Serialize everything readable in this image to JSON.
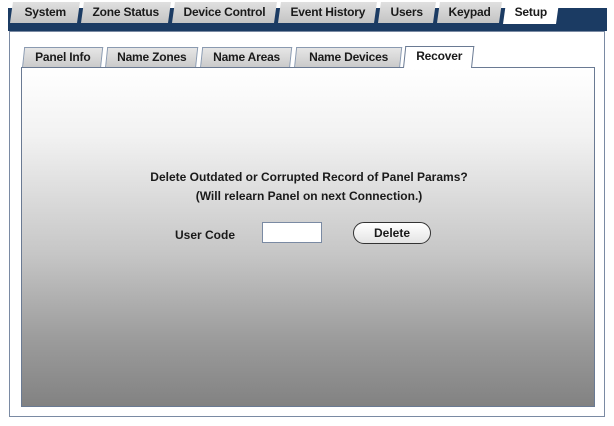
{
  "top_tabs": [
    {
      "label": "System"
    },
    {
      "label": "Zone Status"
    },
    {
      "label": "Device Control"
    },
    {
      "label": "Event History"
    },
    {
      "label": "Users"
    },
    {
      "label": "Keypad"
    },
    {
      "label": "Setup",
      "active": true
    }
  ],
  "setup_tabs": [
    {
      "label": "Panel Info"
    },
    {
      "label": "Name Zones"
    },
    {
      "label": "Name Areas"
    },
    {
      "label": "Name Devices"
    },
    {
      "label": "Recover",
      "active": true
    }
  ],
  "recover": {
    "message_line1": "Delete Outdated or Corrupted Record of Panel Params?",
    "message_line2": "(Will relearn Panel on next Connection.)",
    "user_code_label": "User Code",
    "user_code_value": "",
    "delete_label": "Delete"
  },
  "colors": {
    "tab_bar_background": "#1b3b63",
    "panel_border": "#7a8aa3"
  }
}
